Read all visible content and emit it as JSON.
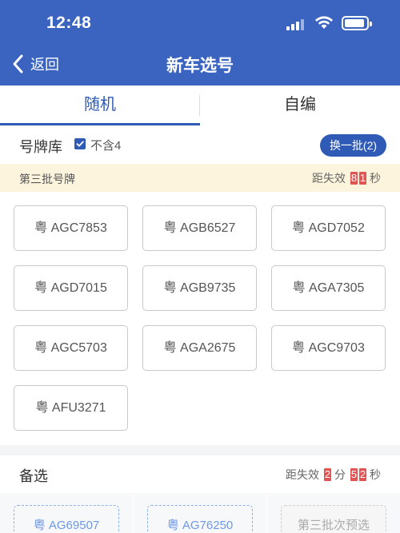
{
  "status_bar": {
    "time": "12:48"
  },
  "nav": {
    "back_label": "返回",
    "title": "新车选号"
  },
  "tabs": [
    {
      "label": "随机",
      "active": true
    },
    {
      "label": "自编",
      "active": false
    }
  ],
  "pool": {
    "label": "号牌库",
    "exclude_four_label": "不含4",
    "exclude_four_checked": true,
    "refresh_button": "换一批(2)"
  },
  "batch": {
    "label": "第三批号牌",
    "expire_prefix": "距失效",
    "expire_digits": [
      "8",
      "1"
    ],
    "expire_unit": "秒"
  },
  "plates": [
    "粤 AGC7853",
    "粤 AGB6527",
    "粤 AGD7052",
    "粤 AGD7015",
    "粤 AGB9735",
    "粤 AGA7305",
    "粤 AGC5703",
    "粤 AGA2675",
    "粤 AGC9703",
    "粤 AFU3271"
  ],
  "alternates": {
    "label": "备选",
    "expire_prefix": "距失效",
    "minute_digit": "2",
    "minute_unit": "分",
    "second_digits": [
      "5",
      "2"
    ],
    "second_unit": "秒",
    "items": [
      {
        "text": "粤 AG69507",
        "disabled": false
      },
      {
        "text": "粤 AG76250",
        "disabled": false
      },
      {
        "text": "第三批次预选",
        "disabled": true
      }
    ]
  },
  "colors": {
    "header_bg": "#3a64c0",
    "accent": "#2f5bb7",
    "countdown_digit": "#e05454",
    "batch_bar_bg": "#fdf4dd"
  }
}
